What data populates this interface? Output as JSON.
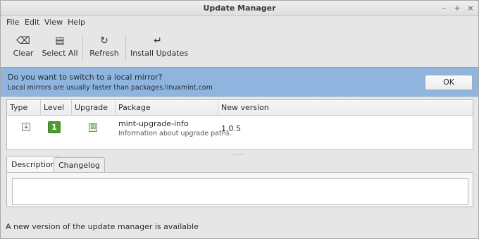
{
  "window": {
    "title": "Update Manager",
    "controls": {
      "minimize": "–",
      "maximize": "+",
      "close": "×"
    }
  },
  "menu": [
    "File",
    "Edit",
    "View",
    "Help"
  ],
  "toolbar": {
    "clear": {
      "label": "Clear",
      "icon": "⌫"
    },
    "select_all": {
      "label": "Select All",
      "icon": "▤"
    },
    "refresh": {
      "label": "Refresh",
      "icon": "↻"
    },
    "install": {
      "label": "Install Updates",
      "icon": "↵"
    }
  },
  "infobar": {
    "title": "Do you want to switch to a local mirror?",
    "subtitle": "Local mirrors are usually faster than packages.linuxmint.com",
    "ok_label": "OK"
  },
  "table": {
    "headers": [
      "Type",
      "Level",
      "Upgrade",
      "Package",
      "New version"
    ],
    "rows": [
      {
        "type_icon": "⇣",
        "level": "1",
        "upgrade_checked": "☒",
        "package": "mint-upgrade-info",
        "description": "Information about upgrade paths.",
        "version": "1.0.5"
      }
    ]
  },
  "divider_grip": ".....",
  "tabs": [
    "Description",
    "Changelog"
  ],
  "status": "A new version of the update manager is available"
}
